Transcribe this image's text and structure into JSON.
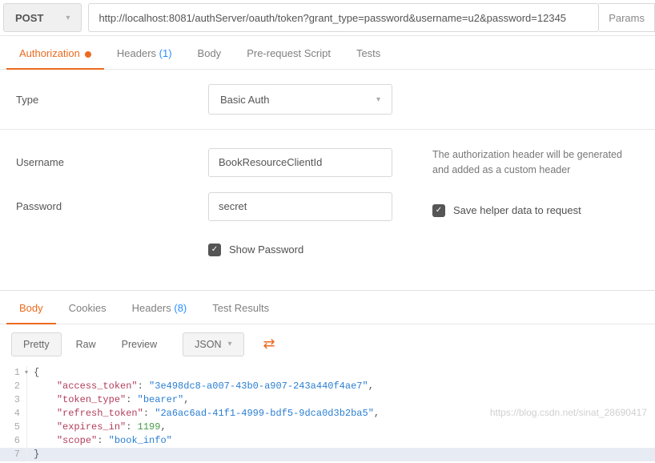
{
  "method": "POST",
  "url": "http://localhost:8081/authServer/oauth/token?grant_type=password&username=u2&password=12345",
  "params_btn": "Params",
  "req_tabs": {
    "auth": "Authorization",
    "headers": "Headers",
    "headers_count": "(1)",
    "body": "Body",
    "prerequest": "Pre-request Script",
    "tests": "Tests"
  },
  "auth": {
    "type_label": "Type",
    "type_value": "Basic Auth",
    "username_label": "Username",
    "username_value": "BookResourceClientId",
    "password_label": "Password",
    "password_value": "secret",
    "show_password": "Show Password",
    "help_text": "The authorization header will be generated and added as a custom header",
    "save_helper": "Save helper data to request"
  },
  "resp_tabs": {
    "body": "Body",
    "cookies": "Cookies",
    "headers": "Headers",
    "headers_count": "(8)",
    "test_results": "Test Results"
  },
  "toolbar": {
    "pretty": "Pretty",
    "raw": "Raw",
    "preview": "Preview",
    "format": "JSON"
  },
  "response": {
    "access_token_key": "\"access_token\"",
    "access_token_val": "\"3e498dc8-a007-43b0-a907-243a440f4ae7\"",
    "token_type_key": "\"token_type\"",
    "token_type_val": "\"bearer\"",
    "refresh_token_key": "\"refresh_token\"",
    "refresh_token_val": "\"2a6ac6ad-41f1-4999-bdf5-9dca0d3b2ba5\"",
    "expires_in_key": "\"expires_in\"",
    "expires_in_val": "1199",
    "scope_key": "\"scope\"",
    "scope_val": "\"book_info\""
  },
  "watermark": "https://blog.csdn.net/sinat_28690417"
}
